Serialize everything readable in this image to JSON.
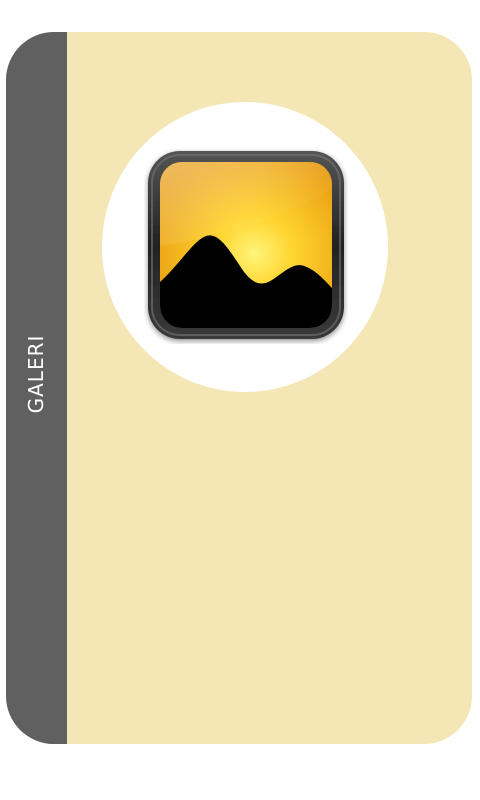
{
  "sidebar": {
    "label": "GALERI"
  },
  "tile": {
    "icon": "gallery-image-icon"
  },
  "colors": {
    "card_background": "#f5e6b6",
    "sidebar_background": "#5f605f",
    "circle_background": "#ffffff",
    "icon_frame": "#2a2a2a",
    "icon_sky": "#f3b21c",
    "icon_sun": "#ffef5a",
    "icon_mountain": "#000000"
  }
}
